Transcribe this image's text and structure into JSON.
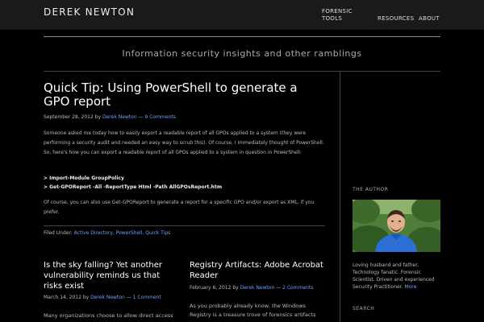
{
  "site": {
    "title": "DEREK NEWTON",
    "tagline": "Information security insights and other ramblings"
  },
  "nav": {
    "items": [
      {
        "label": "FORENSIC TOOLS"
      },
      {
        "label": "RESOURCES"
      },
      {
        "label": "ABOUT"
      }
    ]
  },
  "post": {
    "title": "Quick Tip: Using PowerShell to generate a GPO report",
    "date": "September 28, 2012",
    "by": "by",
    "author": "Derek Newton",
    "dash": "—",
    "comments": "9 Comments",
    "para1": "Someone asked me today how to easily export a readable report of all GPOs applied to a system (they were performing a security audit and needed an easy way to scrub this). Of course, I immediately thought of PowerShell. So, here's how you can export a readable report of all GPOs applied to a system in question in PowerShell:",
    "cmd1": "> Import-Module GroupPolicy",
    "cmd2": "> Get-GPOReport -All -ReportType Html -Path AllGPOsReport.htm",
    "para2": "Of course, you can also use Get-GPOReport to generate a report for a specific GPO and/or export as XML, if you prefer.",
    "filed_under": "Filed Under:",
    "categories": "Active Directory, PowerShell, Quick Tips"
  },
  "sub_posts": [
    {
      "title": "Is the sky falling? Yet another vulnerability reminds us that risks exist",
      "date": "March 14, 2012",
      "by": "by",
      "author": "Derek Newton",
      "dash": "—",
      "comments": "1 Comment",
      "excerpt": "Many organizations choose to allow direct access"
    },
    {
      "title": "Registry Artifacts: Adobe Acrobat Reader",
      "date": "February 6, 2012",
      "by": "by",
      "author": "Derek Newton",
      "dash": "—",
      "comments": "2 Comments",
      "excerpt": "As you probably already know, the Windows Registry is a treasure trove of forensics artifacts"
    }
  ],
  "sidebar": {
    "heading": "THE AUTHOR",
    "bio": "Loving husband and father. Technology fanatic. Forensic Scientist. Driven and experienced Security Practitioner.",
    "bio_link": "More",
    "search_heading": "SEARCH"
  },
  "colors": {
    "background": "#000000",
    "topbar": "#1a1a1a",
    "link": "#6aa3ff"
  }
}
